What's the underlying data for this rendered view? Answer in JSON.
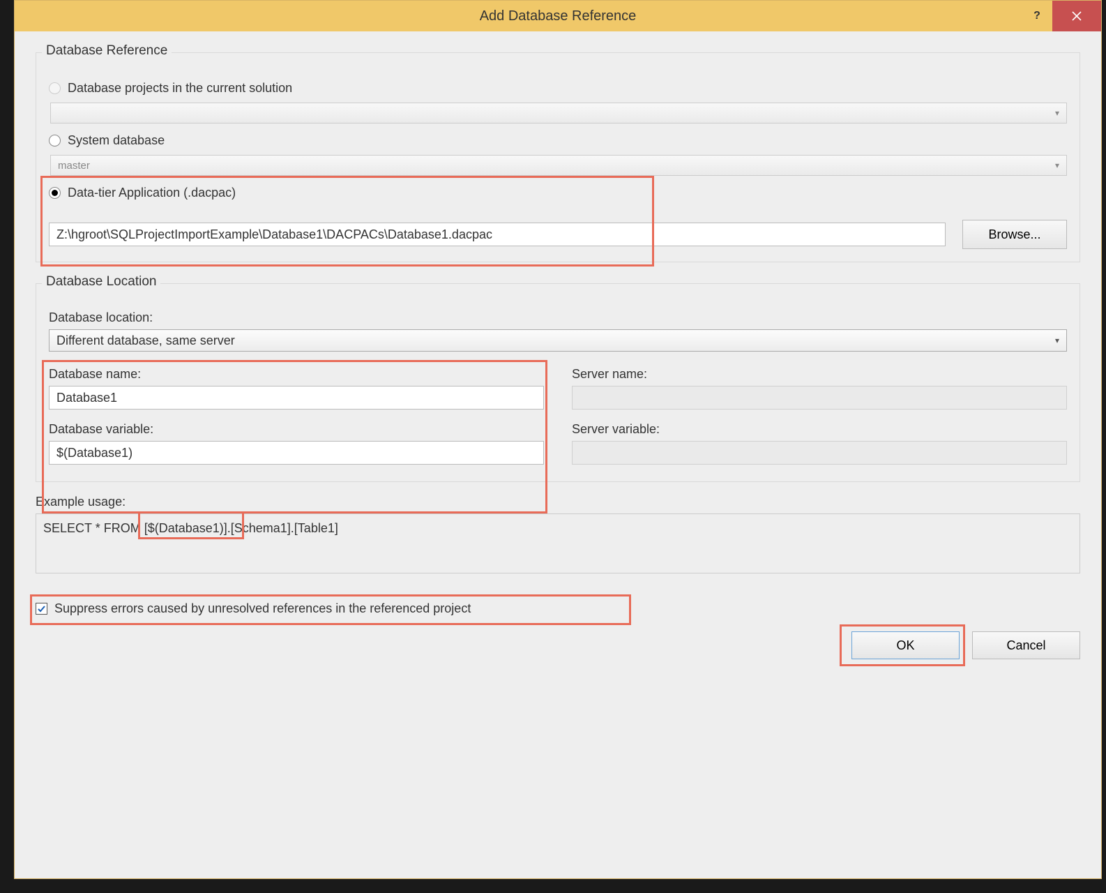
{
  "title": "Add Database Reference",
  "group_db_ref": "Database Reference",
  "radios": {
    "projects": "Database projects in the current solution",
    "system": "System database",
    "dacpac": "Data-tier Application (.dacpac)"
  },
  "system_db_value": "master",
  "dacpac_path": "Z:\\hgroot\\SQLProjectImportExample\\Database1\\DACPACs\\Database1.dacpac",
  "browse_label": "Browse...",
  "group_db_loc": "Database Location",
  "loc_label": "Database location:",
  "loc_value": "Different database, same server",
  "db_name_label": "Database name:",
  "db_name_value": "Database1",
  "db_var_label": "Database variable:",
  "db_var_value": "$(Database1)",
  "server_name_label": "Server name:",
  "server_var_label": "Server variable:",
  "example_label": "Example usage:",
  "example_value": "SELECT * FROM [$(Database1)].[Schema1].[Table1]",
  "suppress_label": "Suppress errors caused by unresolved references in the referenced project",
  "ok_label": "OK",
  "cancel_label": "Cancel"
}
